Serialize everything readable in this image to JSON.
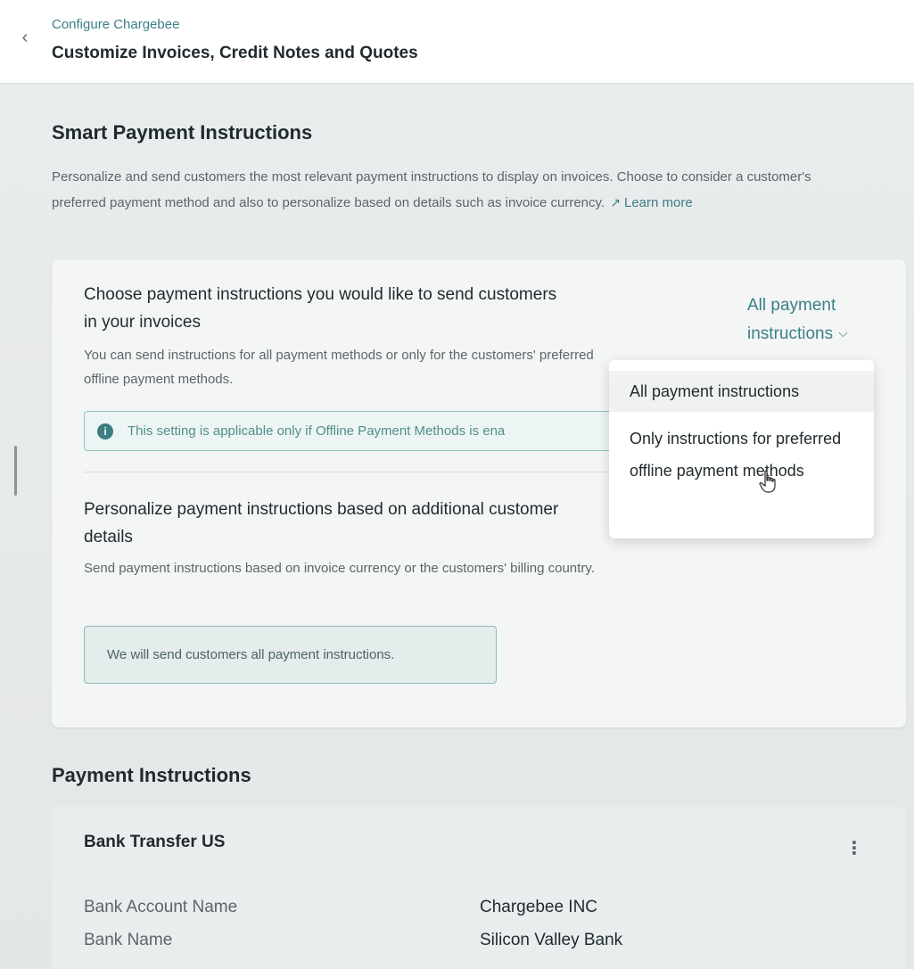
{
  "header": {
    "breadcrumb": "Configure Chargebee",
    "title": "Customize Invoices, Credit Notes and Quotes"
  },
  "smart_payment": {
    "title": "Smart Payment Instructions",
    "description": "Personalize and send customers the most relevant payment instructions to display on invoices. Choose to consider a customer's preferred payment method and also to personalize based on details such as invoice currency.",
    "learn_more": "Learn more",
    "choose": {
      "heading": "Choose payment instructions you would like to send customers in your invoices",
      "subtext": "You can send instructions for all payment methods or only for the customers' preferred offline payment methods."
    },
    "info_note": "This setting is applicable only if Offline Payment Methods is ena",
    "personalize": {
      "heading": "Personalize payment instructions based on additional customer details",
      "subtext": "Send payment instructions based on invoice currency or the customers' billing country."
    },
    "summary": "We will send customers all payment instructions.",
    "dropdown": {
      "selected": "All payment instructions",
      "options": [
        "All payment instructions",
        "Only instructions for preferred offline payment methods"
      ]
    }
  },
  "payment_instructions": {
    "title": "Payment Instructions",
    "card": {
      "title": "Bank Transfer US",
      "rows": [
        {
          "label": "Bank Account Name",
          "value": "Chargebee INC"
        },
        {
          "label": "Bank Name",
          "value": "Silicon Valley Bank"
        }
      ]
    }
  },
  "icons": {
    "back": "chevron-left-icon",
    "external": "external-link-icon",
    "info": "info-icon",
    "chevron": "chevron-down-icon",
    "kebab": "kebab-menu-icon",
    "cursor": "hand-pointer-icon"
  },
  "colors": {
    "accent": "#3b7f86",
    "info_bg": "#edf5f4",
    "background": "#e7eaea"
  }
}
